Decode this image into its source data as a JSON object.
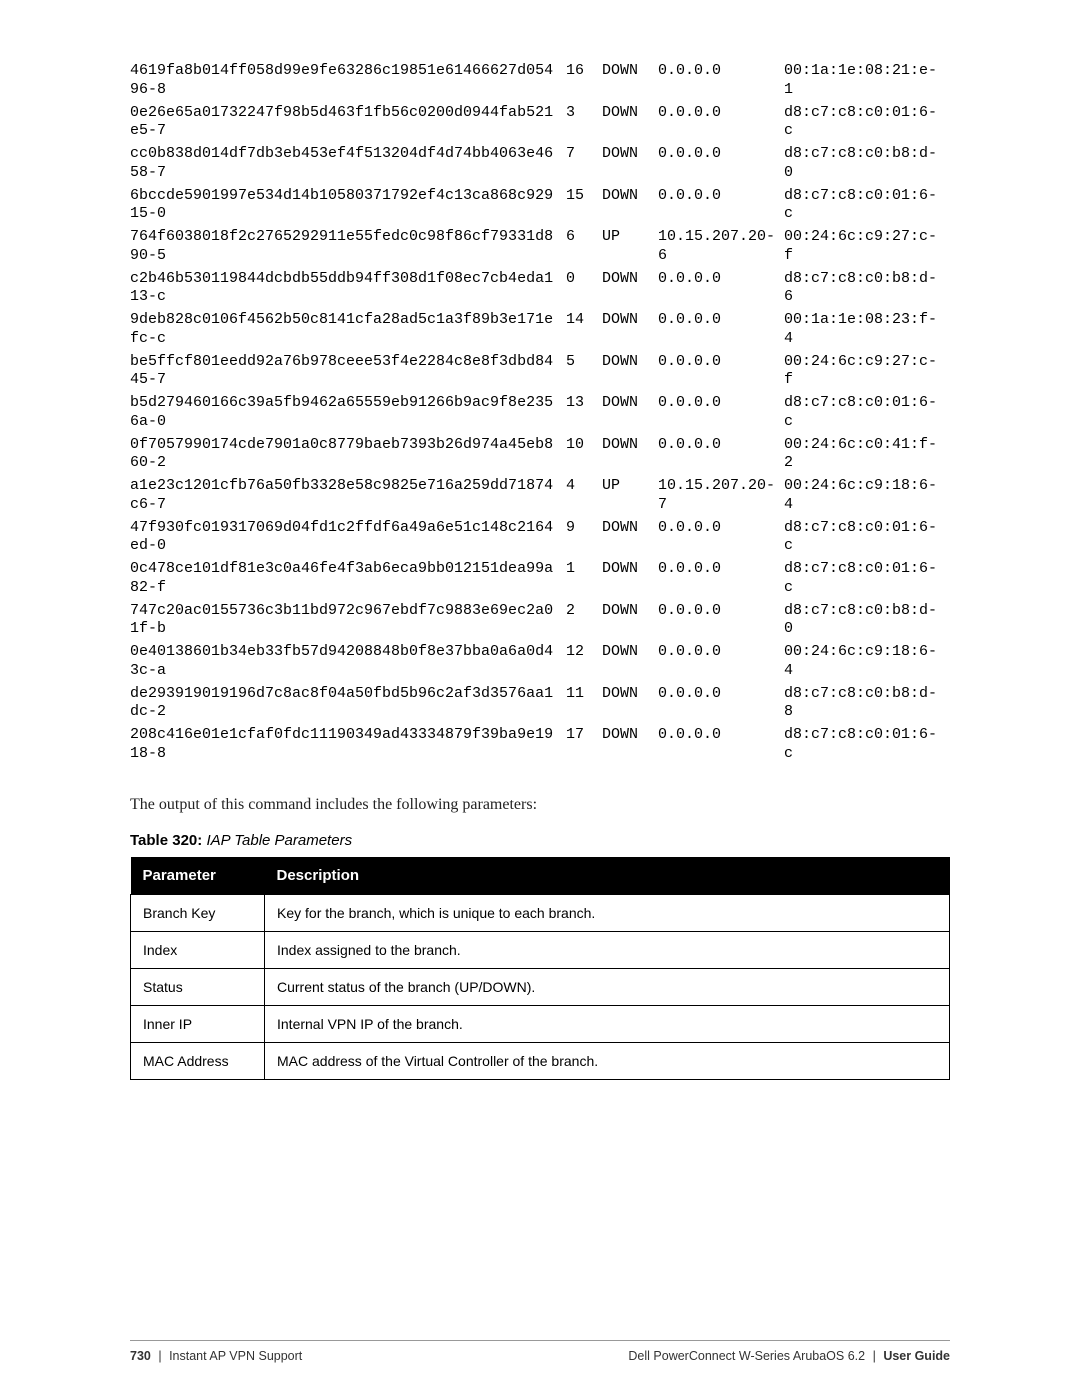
{
  "cli_rows": [
    {
      "key": "4619fa8b014ff058d99e9fe63286c19851e61466627d05496-8",
      "idx": "16",
      "status": "DOWN",
      "ip": "0.0.0.0",
      "mac": "00:1a:1e:08:21:e-1"
    },
    {
      "key": "0e26e65a01732247f98b5d463f1fb56c0200d0944fab521e5-7",
      "idx": "3",
      "status": "DOWN",
      "ip": "0.0.0.0",
      "mac": "d8:c7:c8:c0:01:6-c"
    },
    {
      "key": "cc0b838d014df7db3eb453ef4f513204df4d74bb4063e4658-7",
      "idx": "7",
      "status": "DOWN",
      "ip": "0.0.0.0",
      "mac": "d8:c7:c8:c0:b8:d-0"
    },
    {
      "key": "6bccde5901997e534d14b10580371792ef4c13ca868c92915-0",
      "idx": "15",
      "status": "DOWN",
      "ip": "0.0.0.0",
      "mac": "d8:c7:c8:c0:01:6-c"
    },
    {
      "key": "764f6038018f2c2765292911e55fedc0c98f86cf79331d890-5",
      "idx": "6",
      "status": "UP",
      "ip": "10.15.207.20-6",
      "mac": "00:24:6c:c9:27:c-f"
    },
    {
      "key": "c2b46b530119844dcbdb55ddb94ff308d1f08ec7cb4eda113-c",
      "idx": "0",
      "status": "DOWN",
      "ip": "0.0.0.0",
      "mac": "d8:c7:c8:c0:b8:d-6"
    },
    {
      "key": "9deb828c0106f4562b50c8141cfa28ad5c1a3f89b3e171efc-c",
      "idx": "14",
      "status": "DOWN",
      "ip": "0.0.0.0",
      "mac": "00:1a:1e:08:23:f-4"
    },
    {
      "key": "be5ffcf801eedd92a76b978ceee53f4e2284c8e8f3dbd8445-7",
      "idx": "5",
      "status": "DOWN",
      "ip": "0.0.0.0",
      "mac": "00:24:6c:c9:27:c-f"
    },
    {
      "key": "b5d279460166c39a5fb9462a65559eb91266b9ac9f8e2356a-0",
      "idx": "13",
      "status": "DOWN",
      "ip": "0.0.0.0",
      "mac": "d8:c7:c8:c0:01:6-c"
    },
    {
      "key": "0f7057990174cde7901a0c8779baeb7393b26d974a45eb860-2",
      "idx": "10",
      "status": "DOWN",
      "ip": "0.0.0.0",
      "mac": "00:24:6c:c0:41:f-2"
    },
    {
      "key": "a1e23c1201cfb76a50fb3328e58c9825e716a259dd71874c6-7",
      "idx": "4",
      "status": "UP",
      "ip": "10.15.207.20-7",
      "mac": "00:24:6c:c9:18:6-4"
    },
    {
      "key": "47f930fc019317069d04fd1c2ffdf6a49a6e51c148c2164ed-0",
      "idx": "9",
      "status": "DOWN",
      "ip": "0.0.0.0",
      "mac": "d8:c7:c8:c0:01:6-c"
    },
    {
      "key": "0c478ce101df81e3c0a46fe4f3ab6eca9bb012151dea99a82-f",
      "idx": "1",
      "status": "DOWN",
      "ip": "0.0.0.0",
      "mac": "d8:c7:c8:c0:01:6-c"
    },
    {
      "key": "747c20ac0155736c3b11bd972c967ebdf7c9883e69ec2a01f-b",
      "idx": "2",
      "status": "DOWN",
      "ip": "0.0.0.0",
      "mac": "d8:c7:c8:c0:b8:d-0"
    },
    {
      "key": "0e40138601b34eb33fb57d94208848b0f8e37bba0a6a0d43c-a",
      "idx": "12",
      "status": "DOWN",
      "ip": "0.0.0.0",
      "mac": "00:24:6c:c9:18:6-4"
    },
    {
      "key": "de293919019196d7c8ac8f04a50fbd5b96c2af3d3576aa1dc-2",
      "idx": "11",
      "status": "DOWN",
      "ip": "0.0.0.0",
      "mac": "d8:c7:c8:c0:b8:d-8"
    },
    {
      "key": "208c416e01e1cfaf0fdc11190349ad43334879f39ba9e1918-8",
      "idx": "17",
      "status": "DOWN",
      "ip": "0.0.0.0",
      "mac": "d8:c7:c8:c0:01:6-c"
    }
  ],
  "description": "The output of this command includes the following parameters:",
  "table_label_prefix": "Table 320:",
  "table_label_title": "IAP Table Parameters",
  "param_header": {
    "col1": "Parameter",
    "col2": "Description"
  },
  "params": [
    {
      "name": "Branch Key",
      "desc": "Key for the branch, which is unique to each branch."
    },
    {
      "name": "Index",
      "desc": "Index assigned to the branch."
    },
    {
      "name": "Status",
      "desc": "Current status of the branch (UP/DOWN)."
    },
    {
      "name": "Inner IP",
      "desc": "Internal VPN IP of the branch."
    },
    {
      "name": "MAC Address",
      "desc": "MAC address of the Virtual Controller of the branch."
    }
  ],
  "footer": {
    "page_no": "730",
    "left_sep": "|",
    "left_text": "Instant AP VPN Support",
    "right_text1": "Dell PowerConnect W-Series ArubaOS 6.2",
    "right_sep": "|",
    "right_text2": "User Guide"
  }
}
